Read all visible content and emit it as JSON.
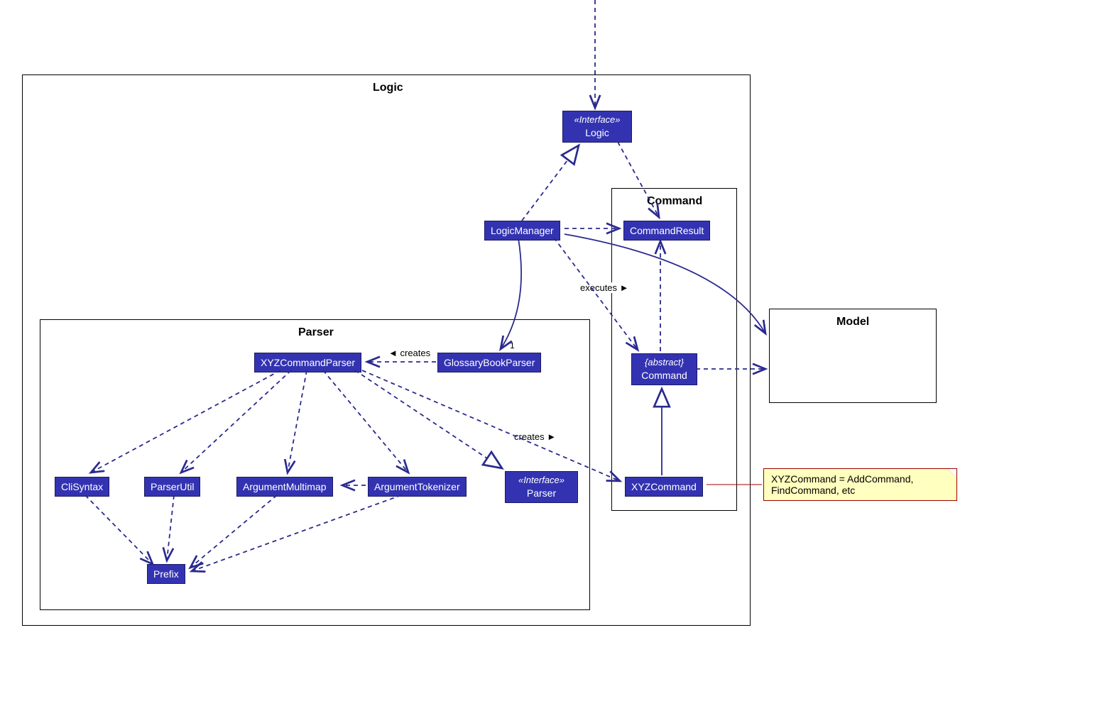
{
  "packages": {
    "logic": {
      "label": "Logic"
    },
    "parser": {
      "label": "Parser"
    },
    "command": {
      "label": "Command"
    },
    "model": {
      "label": "Model"
    }
  },
  "classes": {
    "logicInterface": {
      "stereotype": "«Interface»",
      "name": "Logic"
    },
    "logicManager": {
      "name": "LogicManager"
    },
    "commandResult": {
      "name": "CommandResult"
    },
    "abstractCommand": {
      "stereotype": "{abstract}",
      "name": "Command"
    },
    "xyzCommand": {
      "name": "XYZCommand"
    },
    "xyzCommandParser": {
      "name": "XYZCommandParser"
    },
    "glossaryBookParser": {
      "name": "GlossaryBookParser"
    },
    "cliSyntax": {
      "name": "CliSyntax"
    },
    "parserUtil": {
      "name": "ParserUtil"
    },
    "argumentMultimap": {
      "name": "ArgumentMultimap"
    },
    "argumentTokenizer": {
      "name": "ArgumentTokenizer"
    },
    "parserInterface": {
      "stereotype": "«Interface»",
      "name": "Parser"
    },
    "prefix": {
      "name": "Prefix"
    }
  },
  "labels": {
    "creates1": "creates",
    "creates2": "creates",
    "executes": "executes",
    "mult1": "1"
  },
  "note": {
    "text": "XYZCommand = AddCommand, FindCommand, etc"
  }
}
